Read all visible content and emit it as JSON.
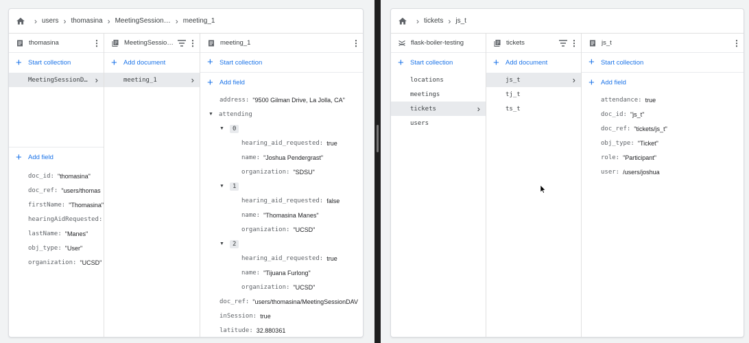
{
  "left": {
    "breadcrumbs": [
      "users",
      "thomasina",
      "MeetingSession…",
      "meeting_1"
    ],
    "col1": {
      "title": "thomasina",
      "start_collection": "Start collection",
      "items": [
        {
          "label": "MeetingSessionD…",
          "selected": true
        }
      ],
      "add_field": "Add field",
      "fields": [
        {
          "k": "doc_id:",
          "v": "\"thomasina\""
        },
        {
          "k": "doc_ref:",
          "v": "\"users/thomas"
        },
        {
          "k": "firstName:",
          "v": "\"Thomasina\""
        },
        {
          "k": "hearingAidRequested:",
          "v": ""
        },
        {
          "k": "lastName:",
          "v": "\"Manes\""
        },
        {
          "k": "obj_type:",
          "v": "\"User\""
        },
        {
          "k": "organization:",
          "v": "\"UCSD\""
        }
      ]
    },
    "col2": {
      "title": "MeetingSession…",
      "add_document": "Add document",
      "items": [
        {
          "label": "meeting_1",
          "selected": true
        }
      ]
    },
    "col3": {
      "title": "meeting_1",
      "start_collection": "Start collection",
      "add_field": "Add field",
      "address_k": "address:",
      "address_v": "\"9500 Gilman Drive, La Jolla, CA\"",
      "attending_k": "attending",
      "entries": [
        {
          "idx": "0",
          "har_k": "hearing_aid_requested:",
          "har_v": "true",
          "name_k": "name:",
          "name_v": "\"Joshua Pendergrast\"",
          "org_k": "organization:",
          "org_v": "\"SDSU\""
        },
        {
          "idx": "1",
          "har_k": "hearing_aid_requested:",
          "har_v": "false",
          "name_k": "name:",
          "name_v": "\"Thomasina Manes\"",
          "org_k": "organization:",
          "org_v": "\"UCSD\""
        },
        {
          "idx": "2",
          "har_k": "hearing_aid_requested:",
          "har_v": "true",
          "name_k": "name:",
          "name_v": "\"Tijuana Furlong\"",
          "org_k": "organization:",
          "org_v": "\"UCSD\""
        }
      ],
      "doc_ref_k": "doc_ref:",
      "doc_ref_v": "\"users/thomasina/MeetingSessionDAV",
      "insession_k": "inSession:",
      "insession_v": "true",
      "latitude_k": "latitude:",
      "latitude_v": "32.880361"
    }
  },
  "right": {
    "breadcrumbs": [
      "tickets",
      "js_t"
    ],
    "col1": {
      "title": "flask-boiler-testing",
      "start_collection": "Start collection",
      "items": [
        {
          "label": "locations",
          "selected": false
        },
        {
          "label": "meetings",
          "selected": false
        },
        {
          "label": "tickets",
          "selected": true
        },
        {
          "label": "users",
          "selected": false
        }
      ]
    },
    "col2": {
      "title": "tickets",
      "add_document": "Add document",
      "items": [
        {
          "label": "js_t",
          "selected": true
        },
        {
          "label": "tj_t",
          "selected": false
        },
        {
          "label": "ts_t",
          "selected": false
        }
      ]
    },
    "col3": {
      "title": "js_t",
      "start_collection": "Start collection",
      "add_field": "Add field",
      "fields": [
        {
          "k": "attendance:",
          "v": "true"
        },
        {
          "k": "doc_id:",
          "v": "\"js_t\""
        },
        {
          "k": "doc_ref:",
          "v": "\"tickets/js_t\""
        },
        {
          "k": "obj_type:",
          "v": "\"Ticket\""
        },
        {
          "k": "role:",
          "v": "\"Participant\""
        },
        {
          "k": "user:",
          "v": "/users/joshua"
        }
      ]
    }
  },
  "colors": {
    "accent": "#1a73e8",
    "selected": "#e8eaed",
    "divider": "#1f1f1f"
  }
}
